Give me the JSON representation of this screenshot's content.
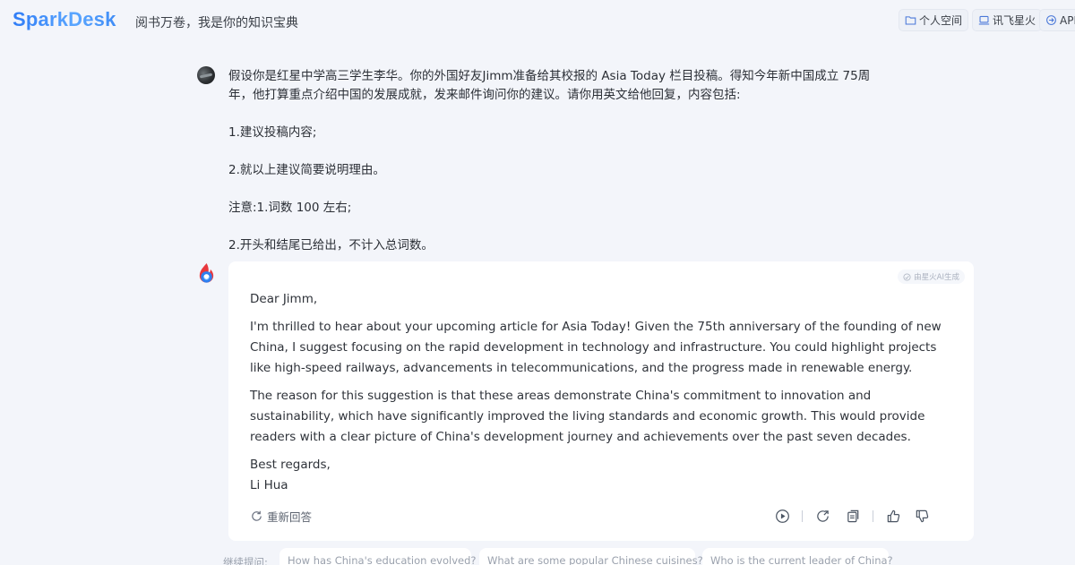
{
  "header": {
    "logo": "SparkDesk",
    "slogan": "阅书万卷，我是你的知识宝典",
    "buttons": [
      {
        "label": "个人空间",
        "icon": "folder-icon"
      },
      {
        "label": "讯飞星火",
        "icon": "laptop-icon"
      },
      {
        "label": "API",
        "icon": "api-icon"
      }
    ]
  },
  "user_message": {
    "lines": [
      "假设你是红星中学高三学生李华。你的外国好友Jimm准备给其校报的 Asia Today 栏目投稿。得知今年新中国成立 75周",
      "年，他打算重点介绍中国的发展成就，发来邮件询问你的建议。请你用英文给他回复，内容包括:",
      "1.建议投稿内容;",
      "2.就以上建议简要说明理由。",
      "注意:1.词数 100 左右;",
      "2.开头和结尾已给出，不计入总词数。"
    ]
  },
  "ai_message": {
    "tag": "由星火AI生成",
    "greeting": "Dear Jimm,",
    "paragraph1": "I'm thrilled to hear about your upcoming article for Asia Today! Given the 75th anniversary of the founding of new China, I suggest focusing on the rapid development in technology and infrastructure. You could highlight projects like high-speed railways, advancements in telecommunications, and the progress made in renewable energy.",
    "paragraph2": "The reason for this suggestion is that these areas demonstrate China's commitment to innovation and sustainability, which have significantly improved the living standards and economic growth. This would provide readers with a clear picture of China's development journey and achievements over the past seven decades.",
    "closing": "Best regards,",
    "signature": "Li Hua",
    "regenerate_label": "重新回答"
  },
  "suggestions": {
    "label": "继续提问:",
    "items": [
      "How has China's education evolved?",
      "What are some popular Chinese cuisines?",
      "Who is the current leader of China?"
    ]
  },
  "colors": {
    "brand": "#3f8cf6",
    "background": "#f3f5fa",
    "card": "#ffffff"
  }
}
